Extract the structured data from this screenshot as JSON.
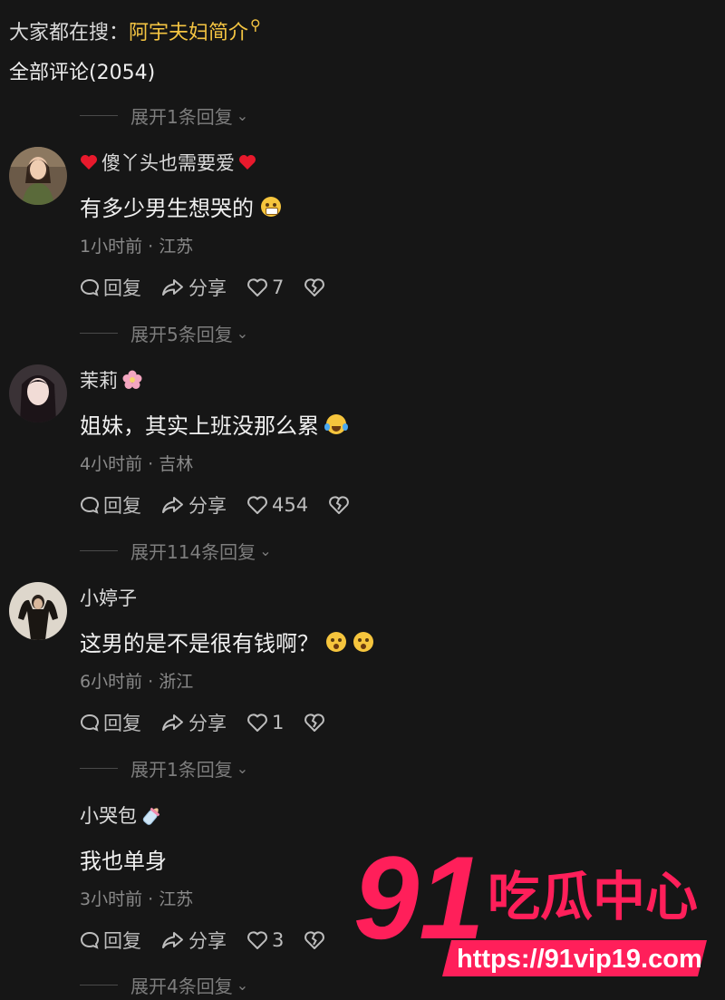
{
  "search": {
    "prefix": "大家都在搜：",
    "keyword": "阿宇夫妇简介",
    "icon": "search-icon"
  },
  "comments_header": {
    "title": "全部评论(2054)"
  },
  "expand_replies": [
    {
      "label": "展开1条回复"
    },
    {
      "label": "展开5条回复"
    },
    {
      "label": "展开114条回复"
    },
    {
      "label": "展开1条回复"
    },
    {
      "label": "展开4条回复"
    }
  ],
  "comments": [
    {
      "username": "傻丫头也需要爱",
      "text": "有多少男生想哭的",
      "time": "1小时前",
      "location": "江苏",
      "likes": "7"
    },
    {
      "username": "茉莉",
      "text": "姐妹，其实上班没那么累",
      "time": "4小时前",
      "location": "吉林",
      "likes": "454"
    },
    {
      "username": "小婷子",
      "text": "这男的是不是很有钱啊？",
      "time": "6小时前",
      "location": "浙江",
      "likes": "1"
    },
    {
      "username": "小哭包",
      "text": "我也单身",
      "time": "3小时前",
      "location": "江苏",
      "likes": "3"
    }
  ],
  "actions": {
    "reply": "回复",
    "share": "分享"
  },
  "meta_separator": " · ",
  "watermark": {
    "number": "91",
    "brand": "吃瓜中心",
    "url": "https://91vip19.com"
  },
  "colors": {
    "background": "#161616",
    "keyword": "#f5c542",
    "watermark": "#ff1f5a"
  }
}
